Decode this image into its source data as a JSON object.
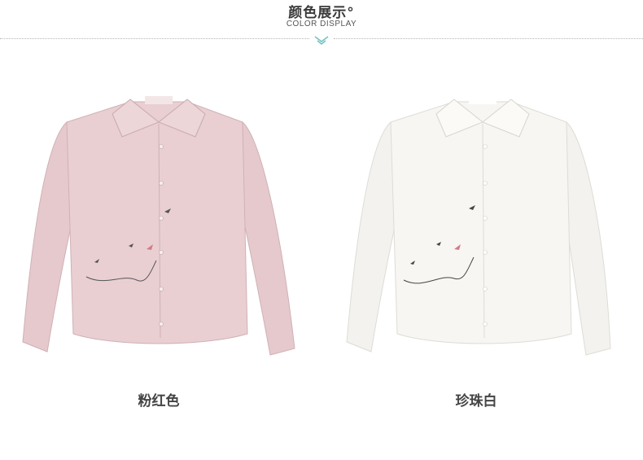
{
  "header": {
    "title": "颜色展示°",
    "subtitle": "COLOR DISPLAY"
  },
  "colors": {
    "accent": "#6fc3c0",
    "divider": "#b7b7b7",
    "pink_shirt": "#e9cfd2",
    "white_shirt": "#f7f6f2"
  },
  "products": [
    {
      "label": "粉红色",
      "color": "#e9cfd2"
    },
    {
      "label": "珍珠白",
      "color": "#f7f6f2"
    }
  ]
}
